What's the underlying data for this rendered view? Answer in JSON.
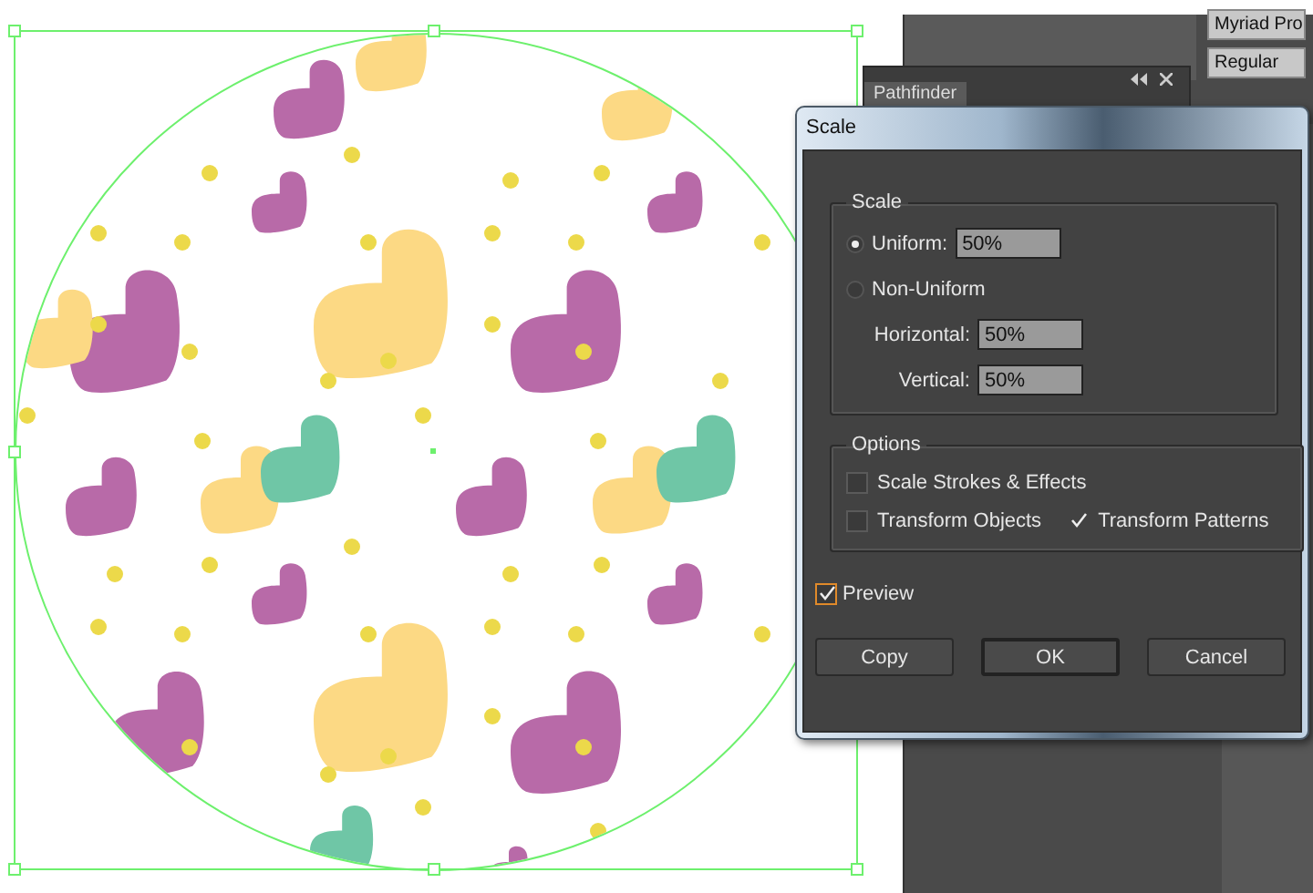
{
  "panels": {
    "font_family": "Myriad Pro",
    "font_style": "Regular",
    "pathfinder_tab": "Pathfinder"
  },
  "dialog": {
    "title": "Scale",
    "scale_group": {
      "title": "Scale",
      "modes": [
        {
          "label": "Uniform:",
          "selected": true,
          "value": "50%"
        },
        {
          "label": "Non-Uniform",
          "selected": false
        }
      ],
      "fields": [
        {
          "label": "Horizontal:",
          "value": "50%"
        },
        {
          "label": "Vertical:",
          "value": "50%"
        }
      ]
    },
    "options_group": {
      "title": "Options",
      "checkboxes": [
        {
          "label": "Scale Strokes & Effects",
          "checked": false
        },
        {
          "label": "Transform Objects",
          "checked": false
        },
        {
          "label": "Transform Patterns",
          "checked": true
        }
      ]
    },
    "preview": {
      "label": "Preview",
      "checked": true
    },
    "buttons": [
      {
        "label": "Copy",
        "default": false
      },
      {
        "label": "OK",
        "default": true
      },
      {
        "label": "Cancel",
        "default": false
      }
    ]
  }
}
